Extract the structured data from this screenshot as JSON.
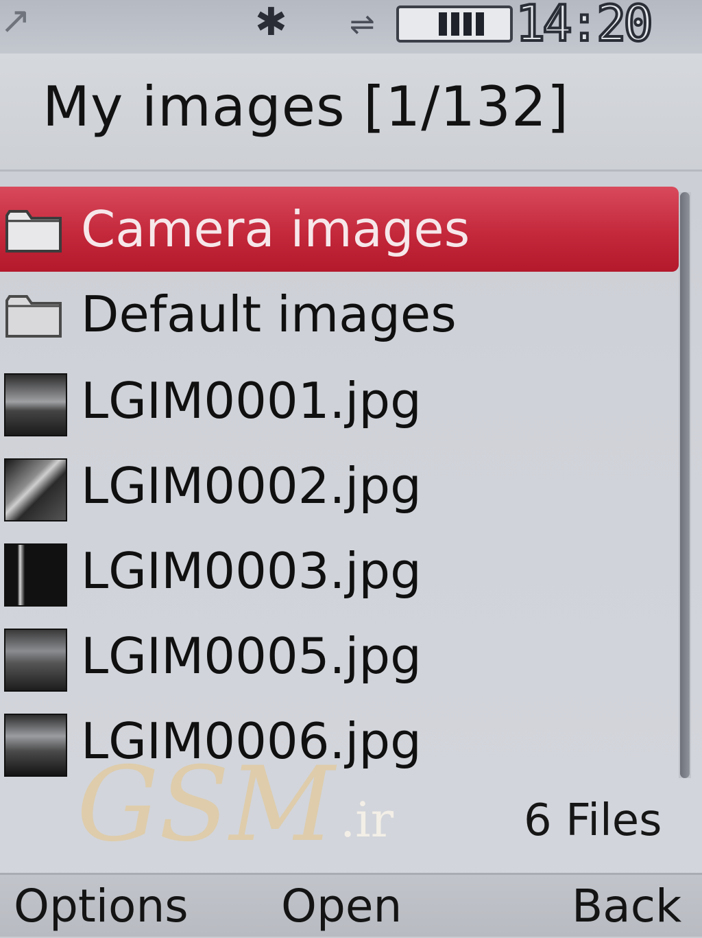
{
  "status_bar": {
    "signal_icon": "signal-strength-icon",
    "bluetooth_icon": "bluetooth-icon",
    "usb_icon": "usb-icon",
    "battery_icon": "battery-icon",
    "battery_level": 0.75,
    "time": "14:20"
  },
  "title": "My images [1/132]",
  "list": {
    "items": [
      {
        "type": "folder",
        "label": "Camera images",
        "icon": "folder-icon",
        "selected": true
      },
      {
        "type": "folder",
        "label": "Default images",
        "icon": "folder-icon",
        "selected": false
      },
      {
        "type": "file",
        "label": "LGIM0001.jpg",
        "icon": "image-thumbnail",
        "selected": false
      },
      {
        "type": "file",
        "label": "LGIM0002.jpg",
        "icon": "image-thumbnail",
        "selected": false
      },
      {
        "type": "file",
        "label": "LGIM0003.jpg",
        "icon": "image-thumbnail",
        "selected": false
      },
      {
        "type": "file",
        "label": "LGIM0005.jpg",
        "icon": "image-thumbnail",
        "selected": false
      },
      {
        "type": "file",
        "label": "LGIM0006.jpg",
        "icon": "image-thumbnail",
        "selected": false
      }
    ],
    "selection_color": "#c4283b"
  },
  "file_count": "6 Files",
  "watermark": {
    "main": "GSM",
    "suffix": ".ir"
  },
  "softkeys": {
    "left": "Options",
    "center": "Open",
    "right": "Back"
  }
}
